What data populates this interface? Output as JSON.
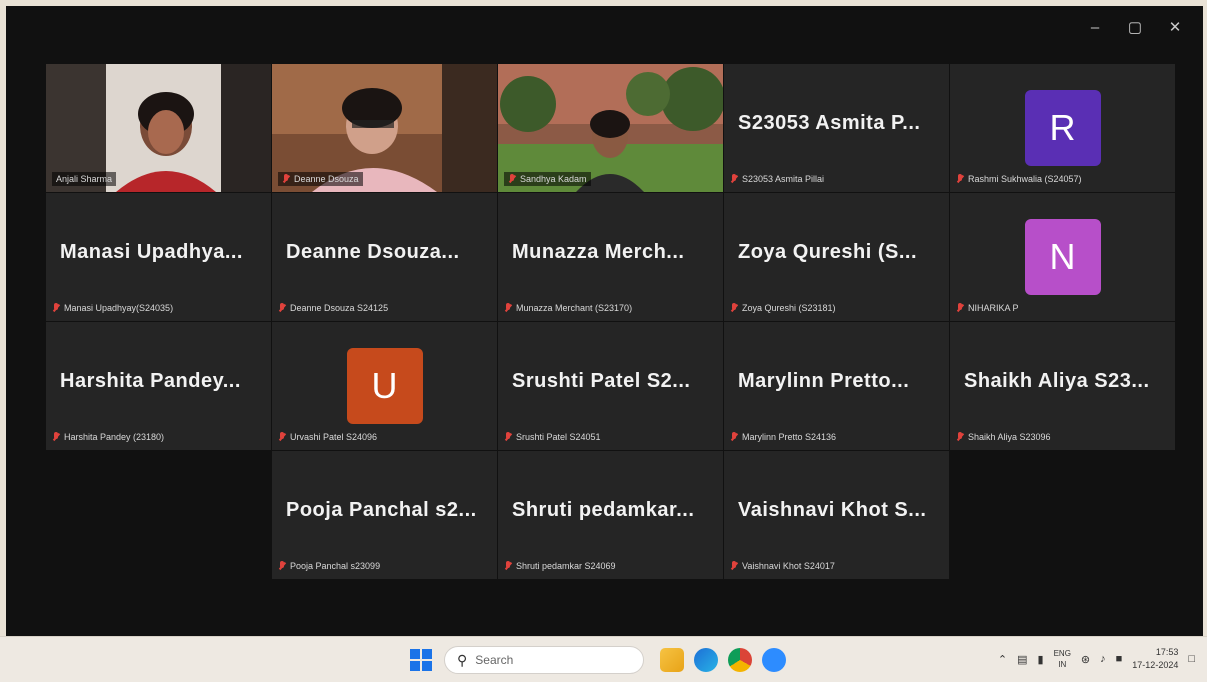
{
  "window": {
    "controls": {
      "minimize": "–",
      "maximize": "▢",
      "close": "✕"
    }
  },
  "tiles": [
    {
      "id": "anjali",
      "video": true,
      "active": true,
      "small_name": "Anjali Sharma"
    },
    {
      "id": "deanne-video",
      "video": true,
      "small_name": "Deanne Dsouza"
    },
    {
      "id": "sandhya",
      "video": true,
      "small_name": "Sandhya Kadam"
    },
    {
      "id": "asmita",
      "big_name": "S23053 Asmita P...",
      "small_name": "S23053 Asmita Pillai"
    },
    {
      "id": "rashmi",
      "avatar_letter": "R",
      "avatar_color": "#5a2fb4",
      "small_name": "Rashmi Sukhwalia (S24057)"
    },
    {
      "id": "manasi",
      "big_name": "Manasi Upadhya...",
      "small_name": "Manasi Upadhyay(S24035)"
    },
    {
      "id": "deanne",
      "big_name": "Deanne Dsouza...",
      "small_name": "Deanne Dsouza S24125"
    },
    {
      "id": "munazza",
      "big_name": "Munazza Merch...",
      "small_name": "Munazza Merchant (S23170)"
    },
    {
      "id": "zoya",
      "big_name": "Zoya Qureshi (S...",
      "small_name": "Zoya Qureshi (S23181)"
    },
    {
      "id": "niharika",
      "avatar_letter": "N",
      "avatar_color": "#b74fc9",
      "small_name": "NIHARIKA P"
    },
    {
      "id": "harshita",
      "big_name": "Harshita Pandey...",
      "small_name": "Harshita Pandey (23180)"
    },
    {
      "id": "urvashi",
      "avatar_letter": "U",
      "avatar_color": "#c64a1c",
      "small_name": "Urvashi Patel S24096"
    },
    {
      "id": "srushti",
      "big_name": "Srushti Patel S2...",
      "small_name": "Srushti Patel S24051"
    },
    {
      "id": "marylinn",
      "big_name": "Marylinn Pretto...",
      "small_name": "Marylinn Pretto S24136"
    },
    {
      "id": "aliya",
      "big_name": "Shaikh Aliya S23...",
      "small_name": "Shaikh Aliya S23096"
    },
    {
      "id": "pooja",
      "big_name": "Pooja Panchal s2...",
      "small_name": "Pooja Panchal s23099"
    },
    {
      "id": "shruti",
      "big_name": "Shruti pedamkar...",
      "small_name": "Shruti pedamkar S24069"
    },
    {
      "id": "vaishnavi",
      "big_name": "Vaishnavi Khot S...",
      "small_name": "Vaishnavi Khot S24017"
    }
  ],
  "taskbar": {
    "search_placeholder": "Search",
    "lang_line1": "ENG",
    "lang_line2": "IN",
    "time": "17:53",
    "date": "17-12-2024"
  }
}
